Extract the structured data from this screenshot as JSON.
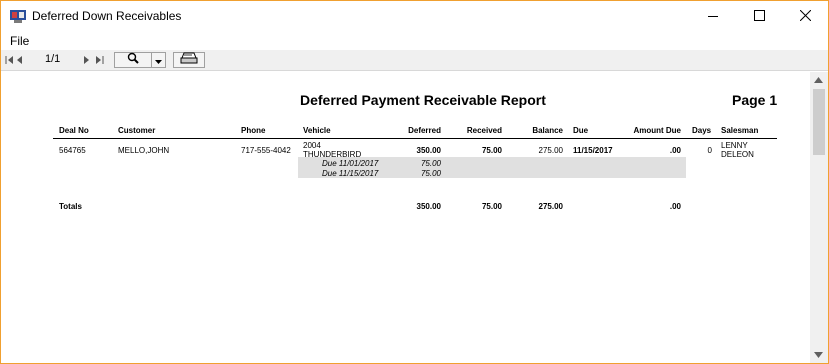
{
  "window": {
    "title": "Deferred Down Receivables"
  },
  "menu": {
    "file": "File"
  },
  "toolbar": {
    "page_indicator": "1/1",
    "icons": [
      "first-page-icon",
      "prev-page-icon",
      "next-page-icon",
      "last-page-icon",
      "zoom-icon",
      "dropdown-arrow-icon",
      "printer-icon"
    ]
  },
  "report": {
    "title": "Deferred Payment Receivable Report",
    "page_label": "Page 1",
    "columns": [
      "Deal No",
      "Customer",
      "Phone",
      "Vehicle",
      "Deferred",
      "Received",
      "Balance",
      "Due",
      "Amount Due",
      "Days",
      "Salesman"
    ],
    "row": {
      "deal_no": "564765",
      "customer": "MELLO,JOHN",
      "phone": "717-555-4042",
      "vehicle_year": "2004",
      "vehicle_model": "THUNDERBIRD",
      "deferred": "350.00",
      "received": "75.00",
      "balance": "275.00",
      "due": "11/15/2017",
      "amount_due": ".00",
      "days": "0",
      "salesman_first": "LENNY",
      "salesman_last": "DELEON"
    },
    "due_lines": [
      {
        "label": "Due 11/01/2017",
        "amount": "75.00"
      },
      {
        "label": "Due 11/15/2017",
        "amount": "75.00"
      }
    ],
    "totals": {
      "label": "Totals",
      "deferred": "350.00",
      "received": "75.00",
      "balance": "275.00",
      "amount_due": ".00"
    }
  },
  "colors": {
    "window_border": "#f0a030",
    "toolbar_bg": "#f0f0f0",
    "due_band": "#e0e0e0"
  }
}
